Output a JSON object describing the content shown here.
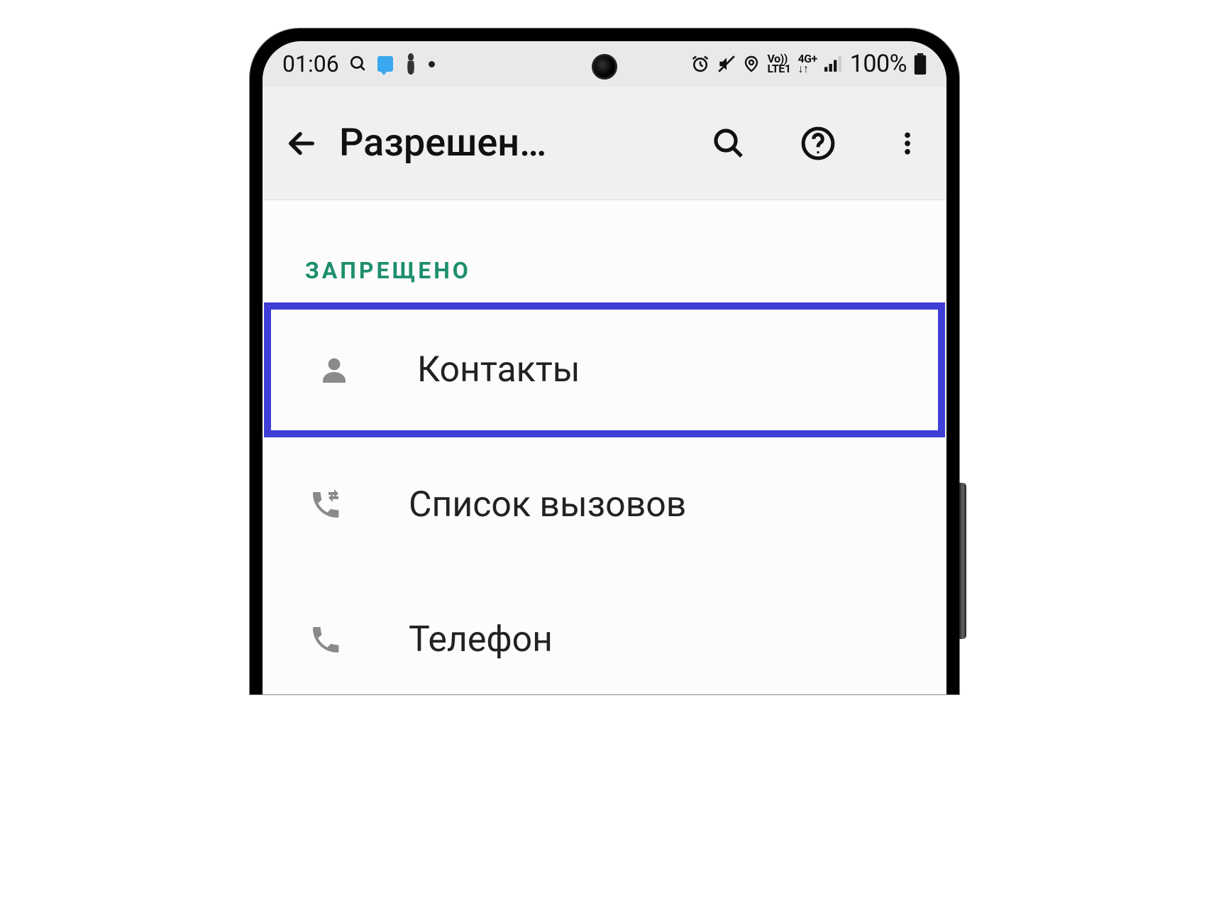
{
  "status_bar": {
    "time": "01:06",
    "battery": "100%",
    "network_label_1": "Vo))",
    "network_label_2": "LTE1",
    "network_label_3": "4G+"
  },
  "app_bar": {
    "title": "Разрешен…"
  },
  "section": {
    "header": "ЗАПРЕЩЕНО"
  },
  "permissions": [
    {
      "label": "Контакты",
      "icon": "person",
      "highlighted": true
    },
    {
      "label": "Список вызовов",
      "icon": "call-log",
      "highlighted": false
    },
    {
      "label": "Телефон",
      "icon": "phone",
      "highlighted": false
    }
  ]
}
